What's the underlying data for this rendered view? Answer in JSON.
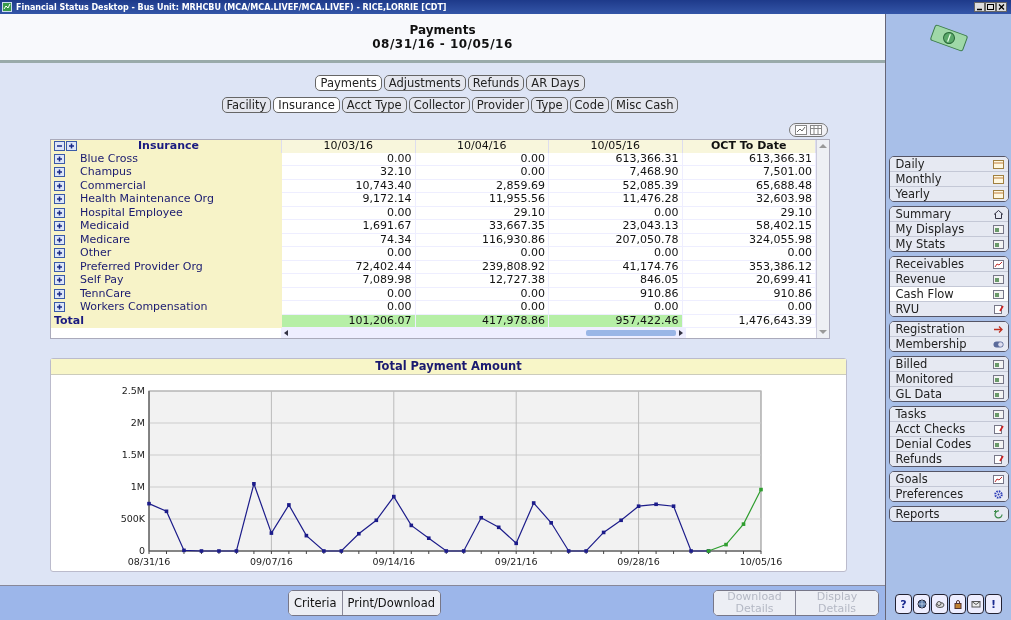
{
  "window": {
    "title": "Financial Status Desktop - Bus Unit: MRHCBU (MCA/MCA.LIVEF/MCA.LIVEF) - RICE,LORRIE [CDT]"
  },
  "header": {
    "title": "Payments",
    "date_range": "08/31/16 - 10/05/16"
  },
  "measure_tabs": [
    {
      "label": "Payments",
      "selected": true
    },
    {
      "label": "Adjustments",
      "selected": false
    },
    {
      "label": "Refunds",
      "selected": false
    },
    {
      "label": "AR Days",
      "selected": false
    }
  ],
  "group_tabs": [
    {
      "label": "Facility",
      "selected": false
    },
    {
      "label": "Insurance",
      "selected": true
    },
    {
      "label": "Acct Type",
      "selected": false
    },
    {
      "label": "Collector",
      "selected": false
    },
    {
      "label": "Provider",
      "selected": false
    },
    {
      "label": "Type",
      "selected": false
    },
    {
      "label": "Code",
      "selected": false
    },
    {
      "label": "Misc Cash",
      "selected": false
    }
  ],
  "table": {
    "columns": [
      "Insurance",
      "10/03/16",
      "10/04/16",
      "10/05/16",
      "OCT To Date"
    ],
    "rows": [
      {
        "name": "Blue Cross",
        "values": [
          "0.00",
          "0.00",
          "613,366.31",
          "613,366.31"
        ]
      },
      {
        "name": "Champus",
        "values": [
          "32.10",
          "0.00",
          "7,468.90",
          "7,501.00"
        ]
      },
      {
        "name": "Commercial",
        "values": [
          "10,743.40",
          "2,859.69",
          "52,085.39",
          "65,688.48"
        ]
      },
      {
        "name": "Health Maintenance Org",
        "values": [
          "9,172.14",
          "11,955.56",
          "11,476.28",
          "32,603.98"
        ]
      },
      {
        "name": "Hospital Employee",
        "values": [
          "0.00",
          "29.10",
          "0.00",
          "29.10"
        ]
      },
      {
        "name": "Medicaid",
        "values": [
          "1,691.67",
          "33,667.35",
          "23,043.13",
          "58,402.15"
        ]
      },
      {
        "name": "Medicare",
        "values": [
          "74.34",
          "116,930.86",
          "207,050.78",
          "324,055.98"
        ]
      },
      {
        "name": "Other",
        "values": [
          "0.00",
          "0.00",
          "0.00",
          "0.00"
        ]
      },
      {
        "name": "Preferred Provider Org",
        "values": [
          "72,402.44",
          "239,808.92",
          "41,174.76",
          "353,386.12"
        ]
      },
      {
        "name": "Self Pay",
        "values": [
          "7,089.98",
          "12,727.38",
          "846.05",
          "20,699.41"
        ]
      },
      {
        "name": "TennCare",
        "values": [
          "0.00",
          "0.00",
          "910.86",
          "910.86"
        ]
      },
      {
        "name": "Workers Compensation",
        "values": [
          "0.00",
          "0.00",
          "0.00",
          "0.00"
        ]
      }
    ],
    "total": {
      "label": "Total",
      "values": [
        "101,206.07",
        "417,978.86",
        "957,422.46",
        "1,476,643.39"
      ]
    }
  },
  "chart": {
    "title": "Total Payment Amount",
    "chart_data": {
      "type": "line",
      "categories": [
        "08/31/16",
        null,
        null,
        null,
        null,
        null,
        null,
        "09/07/16",
        null,
        null,
        null,
        null,
        null,
        null,
        "09/14/16",
        null,
        null,
        null,
        null,
        null,
        null,
        "09/21/16",
        null,
        null,
        null,
        null,
        null,
        null,
        "09/28/16",
        null,
        null,
        null,
        null,
        null,
        null,
        "10/05/16"
      ],
      "grid": true,
      "series": [
        {
          "color": "#1c1c8a",
          "marker": "square",
          "values": [
            740000,
            620000,
            10000,
            0,
            0,
            0,
            1050000,
            280000,
            720000,
            240000,
            0,
            0,
            270000,
            480000,
            850000,
            400000,
            200000,
            0,
            0,
            520000,
            370000,
            120000,
            750000,
            440000,
            0,
            0,
            290000,
            480000,
            700000,
            730000,
            700000,
            0,
            0,
            null,
            null,
            null
          ]
        },
        {
          "color": "#2f9e2f",
          "marker": "square",
          "values": [
            null,
            null,
            null,
            null,
            null,
            null,
            null,
            null,
            null,
            null,
            null,
            null,
            null,
            null,
            null,
            null,
            null,
            null,
            null,
            null,
            null,
            null,
            null,
            null,
            null,
            null,
            null,
            null,
            null,
            null,
            null,
            null,
            0,
            100000,
            420000,
            960000
          ]
        }
      ],
      "ylim": [
        0,
        2500000
      ],
      "yticks": [
        {
          "value": 0,
          "label": "0"
        },
        {
          "value": 500000,
          "label": "500K"
        },
        {
          "value": 1000000,
          "label": "1M"
        },
        {
          "value": 1500000,
          "label": "1.5M"
        },
        {
          "value": 2000000,
          "label": "2M"
        },
        {
          "value": 2500000,
          "label": "2.5M"
        }
      ]
    }
  },
  "view_options": [
    {
      "kind": "chart",
      "selected": false
    },
    {
      "kind": "table",
      "selected": false
    }
  ],
  "action_buttons": [
    {
      "label": "Criteria",
      "disabled": false
    },
    {
      "label": "Print/Download",
      "disabled": false
    }
  ],
  "detail_buttons": [
    {
      "label": "Download Details",
      "disabled": true
    },
    {
      "label": "Display Details",
      "disabled": true
    }
  ],
  "sidebar": {
    "groups": [
      {
        "items": [
          {
            "label": "Daily",
            "selected": false
          },
          {
            "label": "Monthly",
            "selected": false
          },
          {
            "label": "Yearly",
            "selected": false
          }
        ]
      },
      {
        "items": [
          {
            "label": "Summary",
            "selected": false
          },
          {
            "label": "My Displays",
            "selected": false
          },
          {
            "label": "My Stats",
            "selected": false
          }
        ]
      },
      {
        "items": [
          {
            "label": "Receivables",
            "selected": false
          },
          {
            "label": "Revenue",
            "selected": false
          },
          {
            "label": "Cash Flow",
            "selected": true
          },
          {
            "label": "RVU",
            "selected": false
          }
        ]
      },
      {
        "items": [
          {
            "label": "Registration",
            "selected": false
          },
          {
            "label": "Membership",
            "selected": false
          }
        ]
      },
      {
        "items": [
          {
            "label": "Billed",
            "selected": false
          },
          {
            "label": "Monitored",
            "selected": false
          },
          {
            "label": "GL Data",
            "selected": false
          }
        ]
      },
      {
        "items": [
          {
            "label": "Tasks",
            "selected": false
          },
          {
            "label": "Acct Checks",
            "selected": false
          },
          {
            "label": "Denial Codes",
            "selected": false
          },
          {
            "label": "Refunds",
            "selected": false
          }
        ]
      },
      {
        "items": [
          {
            "label": "Goals",
            "selected": false
          },
          {
            "label": "Preferences",
            "selected": false
          }
        ]
      },
      {
        "items": [
          {
            "label": "Reports",
            "selected": false
          }
        ]
      }
    ]
  },
  "tool_buttons": {
    "help": "?",
    "alert": "!"
  }
}
